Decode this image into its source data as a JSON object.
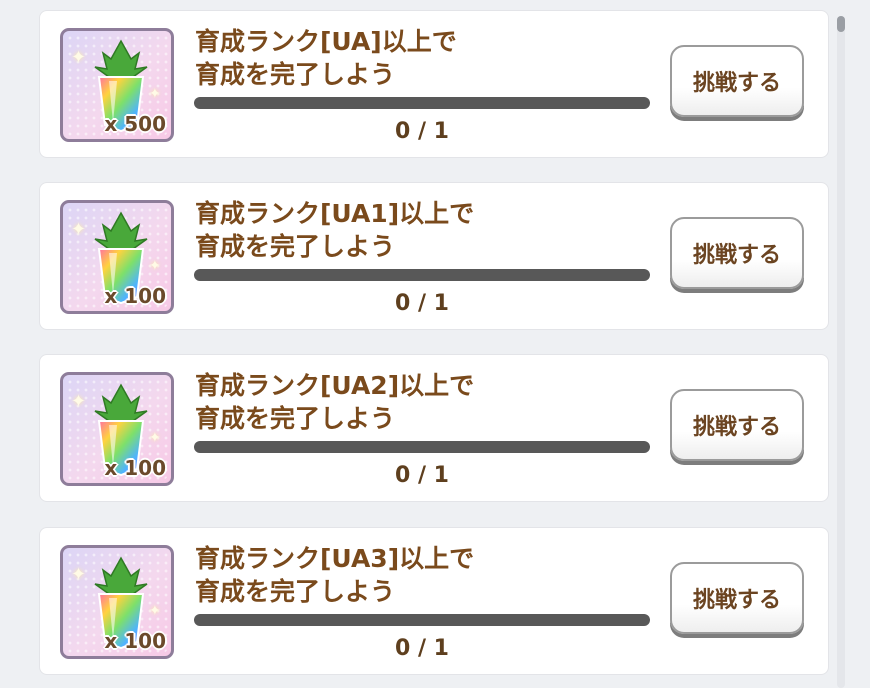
{
  "missions": [
    {
      "title": "育成ランク[UA]以上で\n育成を完了しよう",
      "reward_icon": "rainbow-carat-gem",
      "reward_qty": "x 500",
      "progress_text": "0 / 1",
      "progress": 0,
      "button_label": "挑戦する"
    },
    {
      "title": "育成ランク[UA1]以上で\n育成を完了しよう",
      "reward_icon": "rainbow-carat-gem",
      "reward_qty": "x 100",
      "progress_text": "0 / 1",
      "progress": 0,
      "button_label": "挑戦する"
    },
    {
      "title": "育成ランク[UA2]以上で\n育成を完了しよう",
      "reward_icon": "rainbow-carat-gem",
      "reward_qty": "x 100",
      "progress_text": "0 / 1",
      "progress": 0,
      "button_label": "挑戦する"
    },
    {
      "title": "育成ランク[UA3]以上で\n育成を完了しよう",
      "reward_icon": "rainbow-carat-gem",
      "reward_qty": "x 100",
      "progress_text": "0 / 1",
      "progress": 0,
      "button_label": "挑戦する"
    }
  ],
  "colors": {
    "title_text": "#7a4a1c",
    "progress_track": "#585858",
    "button_text": "#6b4421"
  }
}
